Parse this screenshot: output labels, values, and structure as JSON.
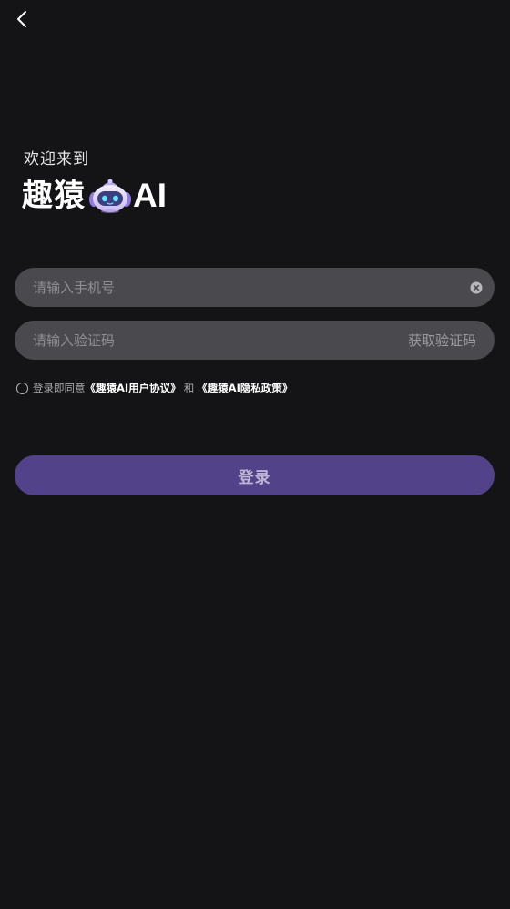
{
  "header": {
    "back_icon": "chevron-left-icon"
  },
  "welcome": {
    "greeting": "欢迎来到",
    "brand_cn": "趣猿",
    "brand_en": "AI",
    "mascot_icon": "robot-mascot-icon"
  },
  "form": {
    "phone": {
      "placeholder": "请输入手机号",
      "value": "",
      "clear_icon": "clear-circle-icon"
    },
    "code": {
      "placeholder": "请输入验证码",
      "value": "",
      "get_code_label": "获取验证码"
    }
  },
  "agreement": {
    "checked": false,
    "prefix": "登录即同意",
    "user_agreement": "《趣猿AI用户协议》",
    "and": "和",
    "privacy_policy": "《趣猿AI隐私政策》"
  },
  "login": {
    "label": "登录"
  },
  "colors": {
    "background": "#141416",
    "field": "#4a4a4e",
    "button": "#52428a",
    "button_text": "#bdb6d6"
  }
}
